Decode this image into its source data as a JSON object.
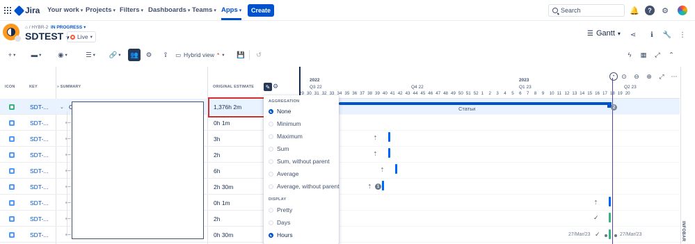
{
  "topnav": {
    "logo_text": "Jira",
    "items": [
      {
        "label": "Your work"
      },
      {
        "label": "Projects"
      },
      {
        "label": "Filters"
      },
      {
        "label": "Dashboards"
      },
      {
        "label": "Teams"
      },
      {
        "label": "Apps"
      }
    ],
    "active_item": "Apps",
    "create_label": "Create",
    "search_placeholder": "Search",
    "icons": [
      "notifications-icon",
      "help-icon",
      "settings-icon",
      "user-avatar"
    ]
  },
  "header": {
    "breadcrumb_key": "HYBR-2",
    "breadcrumb_status": "IN PROGRESS",
    "project_title": "SDTEST",
    "live_label": "Live",
    "view_mode": "Gantt"
  },
  "toolbar": {
    "view_name": "Hybrid view",
    "view_modified_mark": "*"
  },
  "table": {
    "headers": {
      "icon": "ICON",
      "key": "KEY",
      "summary": "SUMMARY",
      "estimate": "ORIGINAL ESTIMATE"
    },
    "rows": [
      {
        "key": "SDT-...",
        "estimate": "1,376h 2m",
        "type": "story"
      },
      {
        "key": "SDT-...",
        "estimate": "0h 1m",
        "type": "subtask"
      },
      {
        "key": "SDT-...",
        "estimate": "3h",
        "type": "subtask"
      },
      {
        "key": "SDT-...",
        "estimate": "2h",
        "type": "subtask"
      },
      {
        "key": "SDT-...",
        "estimate": "6h",
        "type": "subtask"
      },
      {
        "key": "SDT-...",
        "estimate": "2h 30m",
        "type": "subtask"
      },
      {
        "key": "SDT-...",
        "estimate": "0h 1m",
        "type": "subtask"
      },
      {
        "key": "SDT-...",
        "estimate": "2h",
        "type": "subtask"
      },
      {
        "key": "SDT-...",
        "estimate": "0h 30m",
        "type": "subtask"
      }
    ],
    "first_row_summary_prefix": "C"
  },
  "dropdown": {
    "aggregation_title": "AGGREGATION",
    "aggregation_options": [
      {
        "label": "None",
        "selected": true
      },
      {
        "label": "Minimum",
        "selected": false
      },
      {
        "label": "Maximum",
        "selected": false
      },
      {
        "label": "Sum",
        "selected": false
      },
      {
        "label": "Sum, without parent",
        "selected": false
      },
      {
        "label": "Average",
        "selected": false
      },
      {
        "label": "Average, without parent",
        "selected": false
      }
    ],
    "display_title": "DISPLAY",
    "display_options": [
      {
        "label": "Pretty",
        "selected": false
      },
      {
        "label": "Days",
        "selected": false
      },
      {
        "label": "Hours",
        "selected": true
      }
    ]
  },
  "gantt": {
    "years": [
      {
        "label": "2022"
      },
      {
        "label": "2023"
      }
    ],
    "quarters": [
      {
        "label": "Q3 22"
      },
      {
        "label": "Q4 22"
      },
      {
        "label": "Q1 23"
      },
      {
        "label": "Q2 23"
      }
    ],
    "weeks": [
      "29",
      "30",
      "31",
      "32",
      "33",
      "34",
      "35",
      "36",
      "37",
      "38",
      "39",
      "40",
      "41",
      "42",
      "43",
      "44",
      "45",
      "46",
      "47",
      "48",
      "49",
      "50",
      "51",
      "52",
      "1",
      "2",
      "3",
      "4",
      "5",
      "6",
      "7",
      "8",
      "9",
      "10",
      "11",
      "12",
      "13",
      "14",
      "15",
      "16",
      "17",
      "18",
      "19",
      "20"
    ],
    "summary_bar_label": "Статьи",
    "summary_badge": "2",
    "row_count_badge": "1",
    "dates": [
      "27/Mar/23",
      "27/Mar/23"
    ],
    "infobar_label": "INFOBAR"
  }
}
